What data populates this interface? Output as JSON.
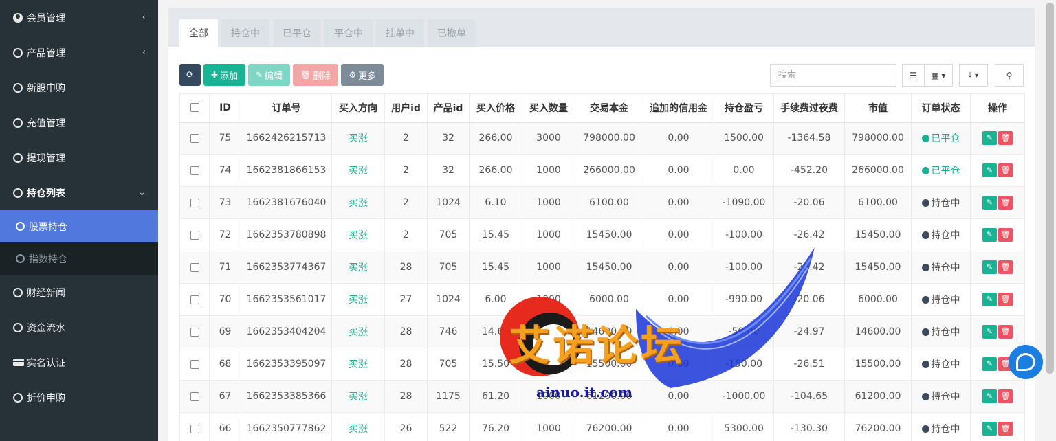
{
  "sidebar": {
    "items": [
      {
        "label": "会员管理",
        "icon": "user-circle-icon",
        "arrow": "‹"
      },
      {
        "label": "产品管理",
        "icon": "circle-icon",
        "arrow": "‹"
      },
      {
        "label": "新股申购",
        "icon": "circle-icon"
      },
      {
        "label": "充值管理",
        "icon": "circle-icon"
      },
      {
        "label": "提现管理",
        "icon": "circle-icon"
      },
      {
        "label": "持仓列表",
        "icon": "circle-icon",
        "arrow": "⌄"
      }
    ],
    "submenu": [
      {
        "label": "股票持仓",
        "active": true
      },
      {
        "label": "指数持仓",
        "active": false
      }
    ],
    "items_after": [
      {
        "label": "财经新闻",
        "icon": "circle-icon"
      },
      {
        "label": "资金流水",
        "icon": "circle-icon"
      },
      {
        "label": "实名认证",
        "icon": "id-card-icon"
      },
      {
        "label": "折价申购",
        "icon": "circle-icon"
      }
    ]
  },
  "tabs": [
    "全部",
    "持仓中",
    "已平仓",
    "平仓中",
    "挂单中",
    "已撤单"
  ],
  "toolbar": {
    "add": "添加",
    "edit": "编辑",
    "delete": "删除",
    "more": "更多"
  },
  "search": {
    "placeholder": "搜索"
  },
  "table": {
    "headers": [
      "ID",
      "订单号",
      "买入方向",
      "用户id",
      "产品id",
      "买入价格",
      "买入数量",
      "交易本金",
      "追加的信用金",
      "持仓盈亏",
      "手续费过夜费",
      "市值",
      "订单状态",
      "操作"
    ],
    "rows": [
      [
        "75",
        "1662426215713",
        "买涨",
        "2",
        "32",
        "266.00",
        "3000",
        "798000.00",
        "0.00",
        "1500.00",
        "-1364.58",
        "798000.00",
        "已平仓"
      ],
      [
        "74",
        "1662381866153",
        "买涨",
        "2",
        "32",
        "266.00",
        "1000",
        "266000.00",
        "0.00",
        "0.00",
        "-452.20",
        "266000.00",
        "已平仓"
      ],
      [
        "73",
        "1662381676040",
        "买涨",
        "2",
        "1024",
        "6.10",
        "1000",
        "6100.00",
        "0.00",
        "-1090.00",
        "-20.06",
        "6100.00",
        "持仓中"
      ],
      [
        "72",
        "1662353780898",
        "买涨",
        "2",
        "705",
        "15.45",
        "1000",
        "15450.00",
        "0.00",
        "-100.00",
        "-26.42",
        "15450.00",
        "持仓中"
      ],
      [
        "71",
        "1662353774367",
        "买涨",
        "28",
        "705",
        "15.45",
        "1000",
        "15450.00",
        "0.00",
        "-100.00",
        "-26.42",
        "15450.00",
        "持仓中"
      ],
      [
        "70",
        "1662353561017",
        "买涨",
        "27",
        "1024",
        "6.00",
        "1000",
        "6000.00",
        "0.00",
        "-990.00",
        "-20.06",
        "6000.00",
        "持仓中"
      ],
      [
        "69",
        "1662353404204",
        "买涨",
        "28",
        "746",
        "14.60",
        "1000",
        "14600.00",
        "0.00",
        "-50.00",
        "-24.97",
        "14600.00",
        "持仓中"
      ],
      [
        "68",
        "1662353395097",
        "买涨",
        "28",
        "705",
        "15.50",
        "1000",
        "15500.00",
        "0.00",
        "-150.00",
        "-26.51",
        "15500.00",
        "持仓中"
      ],
      [
        "67",
        "1662353385366",
        "买涨",
        "28",
        "1175",
        "61.20",
        "1000",
        "61200.00",
        "0.00",
        "-1000.00",
        "-104.65",
        "61200.00",
        "持仓中"
      ],
      [
        "66",
        "1662350777862",
        "买涨",
        "26",
        "522",
        "76.20",
        "1000",
        "76200.00",
        "0.00",
        "5300.00",
        "-130.30",
        "76200.00",
        "持仓中"
      ]
    ]
  },
  "watermark": {
    "title": "艾诺论坛",
    "url": "ainuo.it.com"
  },
  "colors": {
    "sidebar_bg": "#263238",
    "active_menu": "#5178dc",
    "green": "#1ab394",
    "red": "#ed5565"
  }
}
